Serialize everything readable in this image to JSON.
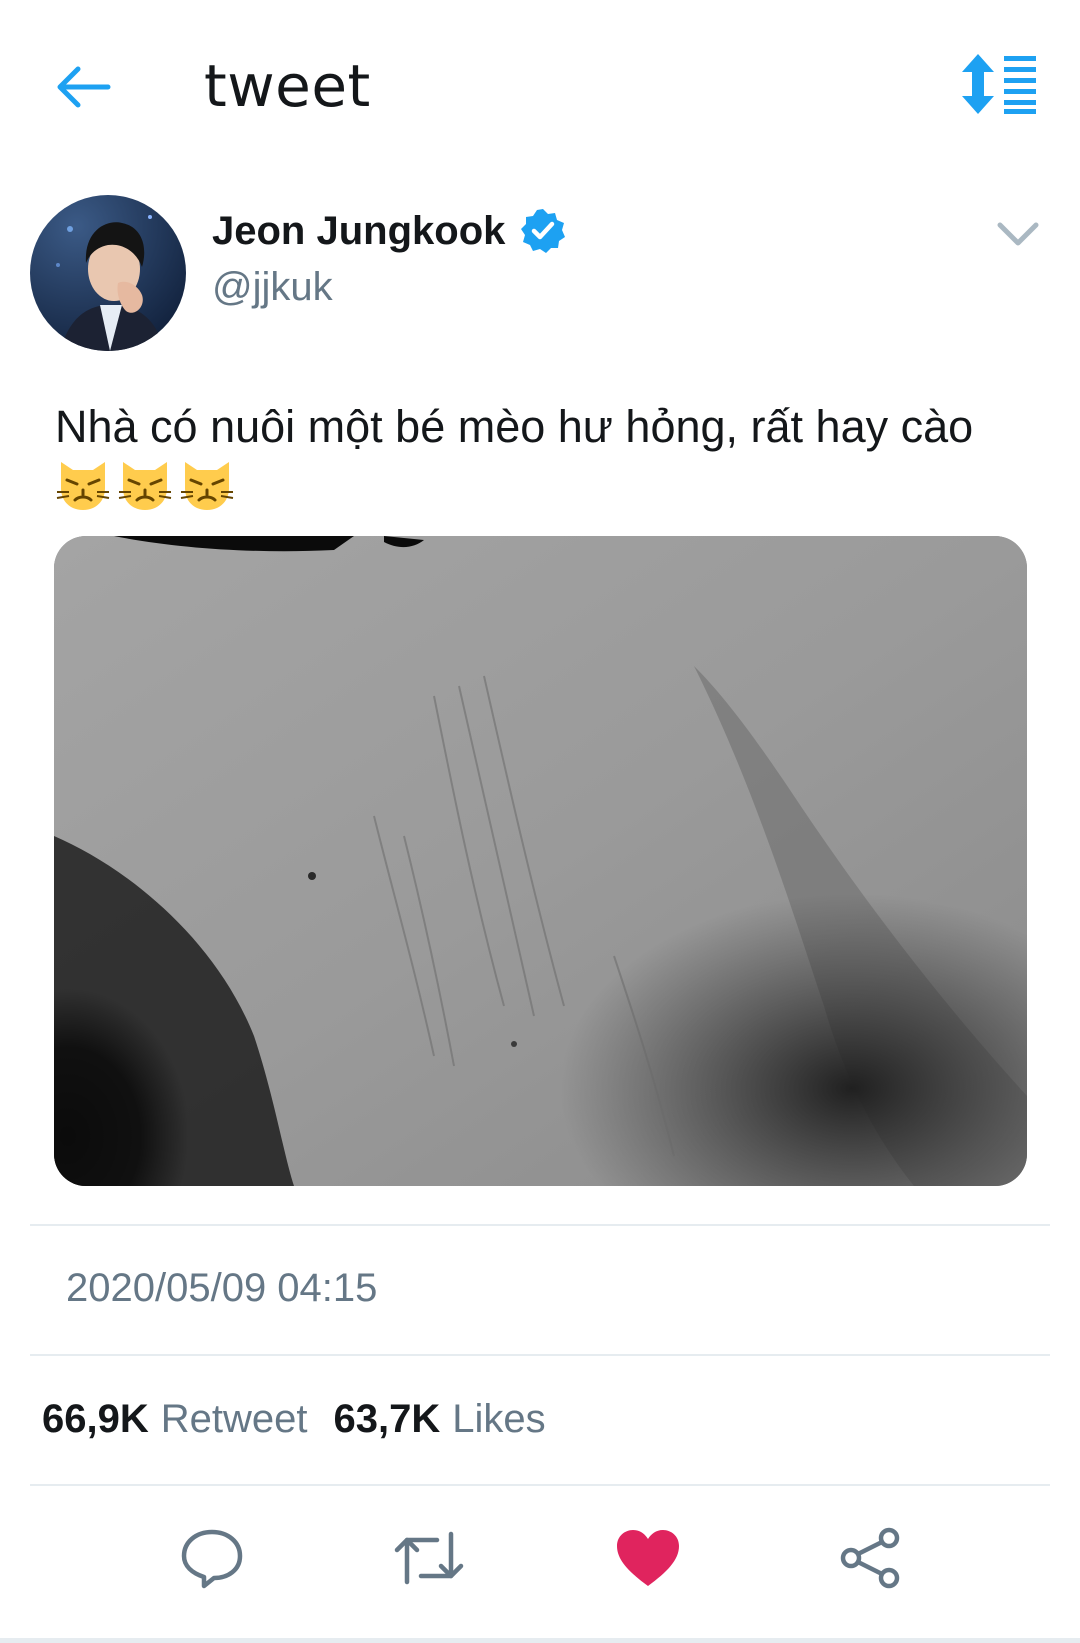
{
  "header": {
    "title": "tweet",
    "back_icon": "arrow-left-icon",
    "sort_icon": "sort-order-icon",
    "accent_color": "#1da1f2"
  },
  "tweet": {
    "author": {
      "display_name": "Jeon Jungkook",
      "handle": "@jjkuk",
      "verified": true
    },
    "text": "Nhà có nuôi một bé mèo hư hỏng, rất hay cào",
    "emoji": [
      "😾",
      "😾",
      "😾"
    ],
    "timestamp": "2020/05/09 04:15",
    "stats": {
      "retweets_count": "66,9K",
      "retweets_label": "Retweet",
      "likes_count": "63,7K",
      "likes_label": "Likes"
    },
    "actions": {
      "reply_icon": "reply-icon",
      "retweet_icon": "retweet-icon",
      "like_icon": "heart-icon",
      "share_icon": "share-icon",
      "liked": true,
      "like_color": "#e0245e"
    }
  }
}
